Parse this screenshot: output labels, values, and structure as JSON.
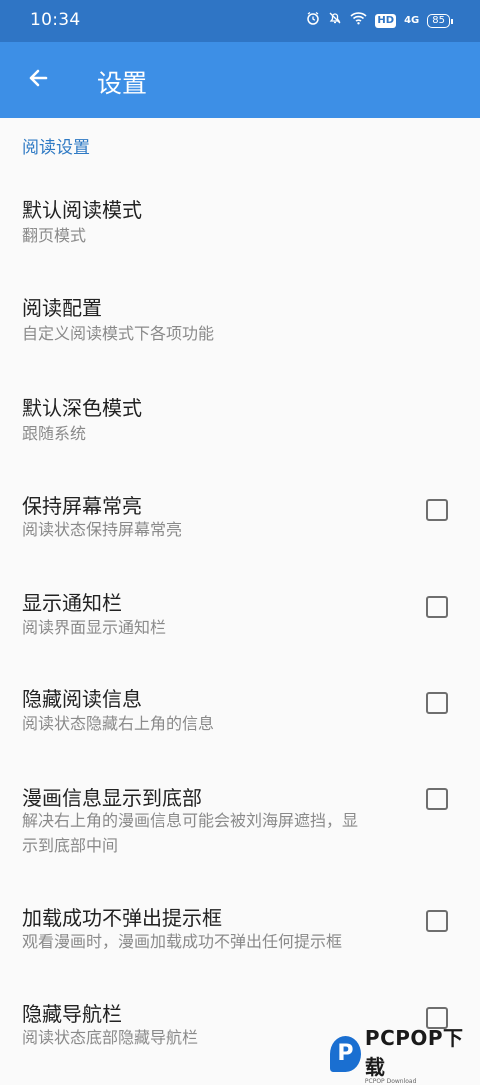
{
  "status_bar": {
    "time": "10:34",
    "icons": [
      "alarm-icon",
      "mute-icon",
      "wifi-icon",
      "hd-icon",
      "signal-icon",
      "battery-icon"
    ],
    "hd": "HD",
    "signal": "4G",
    "battery": "85"
  },
  "app_bar": {
    "title": "设置",
    "back_icon": "arrow-left-icon"
  },
  "section": {
    "header": "阅读设置"
  },
  "items": [
    {
      "title": "默认阅读模式",
      "subtitle": "翻页模式",
      "has_checkbox": false
    },
    {
      "title": "阅读配置",
      "subtitle": "自定义阅读模式下各项功能",
      "has_checkbox": false
    },
    {
      "title": "默认深色模式",
      "subtitle": "跟随系统",
      "has_checkbox": false
    },
    {
      "title": "保持屏幕常亮",
      "subtitle": "阅读状态保持屏幕常亮",
      "has_checkbox": true,
      "checked": false
    },
    {
      "title": "显示通知栏",
      "subtitle": "阅读界面显示通知栏",
      "has_checkbox": true,
      "checked": false
    },
    {
      "title": "隐藏阅读信息",
      "subtitle": "阅读状态隐藏右上角的信息",
      "has_checkbox": true,
      "checked": false
    },
    {
      "title": "漫画信息显示到底部",
      "subtitle_line1": "解决右上角的漫画信息可能会被刘海屏遮挡，显",
      "subtitle_line2": "示到底部中间",
      "has_checkbox": true,
      "checked": false
    },
    {
      "title": "加载成功不弹出提示框",
      "subtitle": "观看漫画时，漫画加载成功不弹出任何提示框",
      "has_checkbox": true,
      "checked": false
    },
    {
      "title": "隐藏导航栏",
      "subtitle": "阅读状态底部隐藏导航栏",
      "has_checkbox": true,
      "checked": false
    }
  ],
  "watermark": {
    "logo_letter": "P",
    "text": "PCPOP下载",
    "subtext": "PCPOP Download"
  },
  "colors": {
    "status_bar": "#2f75c5",
    "app_bar": "#3d8fe6",
    "section_header": "#2f7ac4",
    "background": "#fafafa"
  }
}
